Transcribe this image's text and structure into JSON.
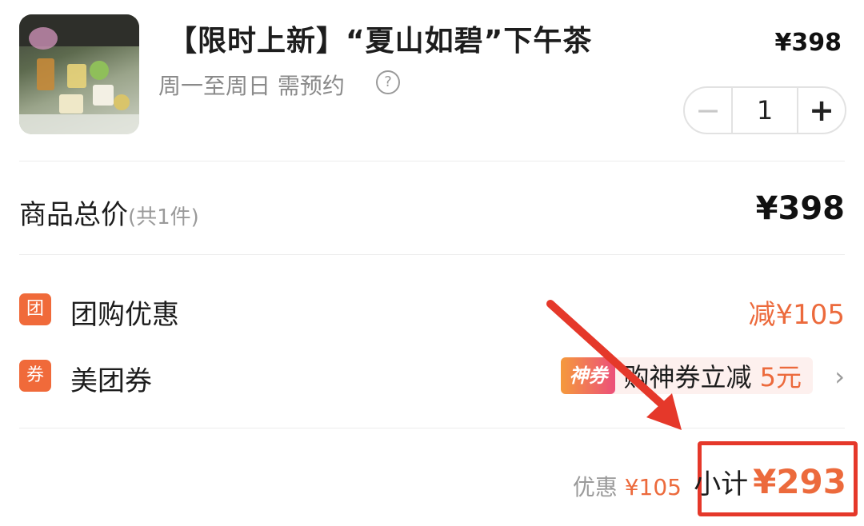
{
  "product": {
    "title": "【限时上新】“夏山如碧”下午茶",
    "subtitle": "周一至周日 需预约",
    "help_icon": "?",
    "price": "¥398",
    "quantity": "1",
    "minus_label": "−",
    "plus_label": "+"
  },
  "total": {
    "label": "商品总价",
    "count": "(共1件)",
    "value": "¥398"
  },
  "discounts": [
    {
      "badge": "团",
      "label": "团购优惠",
      "value": "减¥105"
    },
    {
      "badge": "券",
      "label": "美团券",
      "tag": "神券",
      "text": "购神券立减",
      "amount": "5元",
      "chevron": "›"
    }
  ],
  "summary": {
    "saved_label": "优惠",
    "saved_value": "¥105",
    "subtotal_label": "小计",
    "subtotal_value": "¥293"
  },
  "colors": {
    "accent": "#ec6a3c",
    "badge": "#f06a3a",
    "highlight": "#e5382a"
  }
}
